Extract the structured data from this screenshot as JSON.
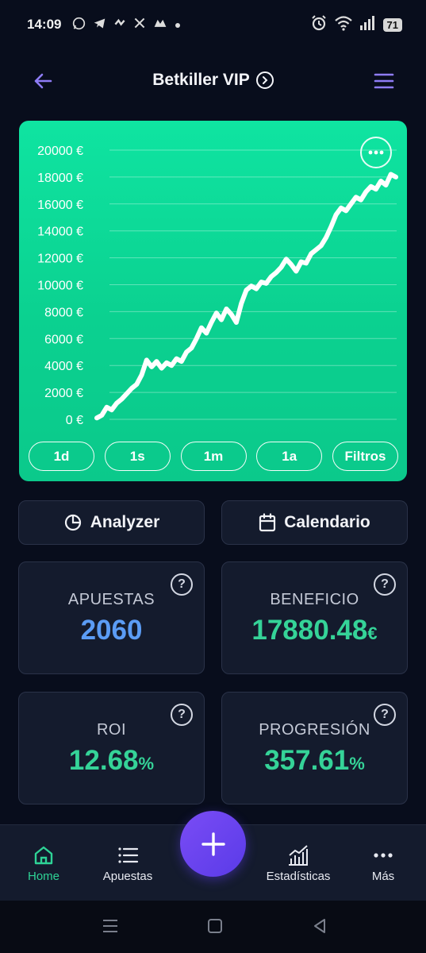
{
  "status_bar": {
    "time": "14:09",
    "battery": "71",
    "left_icons": [
      "whatsapp-icon",
      "telegram-icon",
      "app-icon",
      "x-icon",
      "app-icon-2",
      "dot"
    ],
    "right_icons": [
      "alarm-icon",
      "wifi-icon",
      "signal-icon",
      "battery-icon"
    ]
  },
  "header": {
    "title": "Betkiller VIP"
  },
  "colors": {
    "background": "#080d1c",
    "card": "#141b2d",
    "chart_green": "#0fe4a1",
    "accent_purple": "#6a44f0",
    "value_blue": "#5b9cf5",
    "value_green": "#35d398",
    "nav_active": "#2ed396"
  },
  "chart_data": {
    "type": "line",
    "title": "",
    "xlabel": "",
    "ylabel": "",
    "ylim": [
      0,
      20000
    ],
    "y_ticks": [
      0,
      2000,
      4000,
      6000,
      8000,
      10000,
      12000,
      14000,
      16000,
      18000,
      20000
    ],
    "y_tick_labels": [
      "0 €",
      "2000 €",
      "4000 €",
      "6000 €",
      "8000 €",
      "10000 €",
      "12000 €",
      "14000 €",
      "16000 €",
      "18000 €",
      "20000 €"
    ],
    "grid": true,
    "series": [
      {
        "values": [
          100,
          300,
          900,
          700,
          1200,
          1500,
          1900,
          2300,
          2600,
          3300,
          4400,
          3900,
          4300,
          3800,
          4200,
          4000,
          4500,
          4300,
          5000,
          5300,
          6000,
          6800,
          6400,
          7200,
          7900,
          7400,
          8200,
          7800,
          7200,
          8600,
          9600,
          9900,
          9700,
          10200,
          10100,
          10600,
          10900,
          11300,
          11900,
          11500,
          11000,
          11700,
          11600,
          12300,
          12600,
          12900,
          13500,
          14300,
          15200,
          15700,
          15500,
          16000,
          16500,
          16300,
          16900,
          17300,
          17100,
          17700,
          17400,
          18200,
          18000
        ]
      }
    ],
    "range_buttons": [
      "1d",
      "1s",
      "1m",
      "1a",
      "Filtros"
    ]
  },
  "actions": {
    "analyzer": "Analyzer",
    "calendar": "Calendario"
  },
  "stats": {
    "bets": {
      "label": "APUESTAS",
      "value": "2060",
      "unit": ""
    },
    "profit": {
      "label": "BENEFICIO",
      "value": "17880.48",
      "unit": "€"
    },
    "roi": {
      "label": "ROI",
      "value": "12.68",
      "unit": "%"
    },
    "progression": {
      "label": "PROGRESIÓN",
      "value": "357.61",
      "unit": "%"
    }
  },
  "bottom_nav": {
    "home": "Home",
    "bets": "Apuestas",
    "stats": "Estadísticas",
    "more": "Más"
  }
}
